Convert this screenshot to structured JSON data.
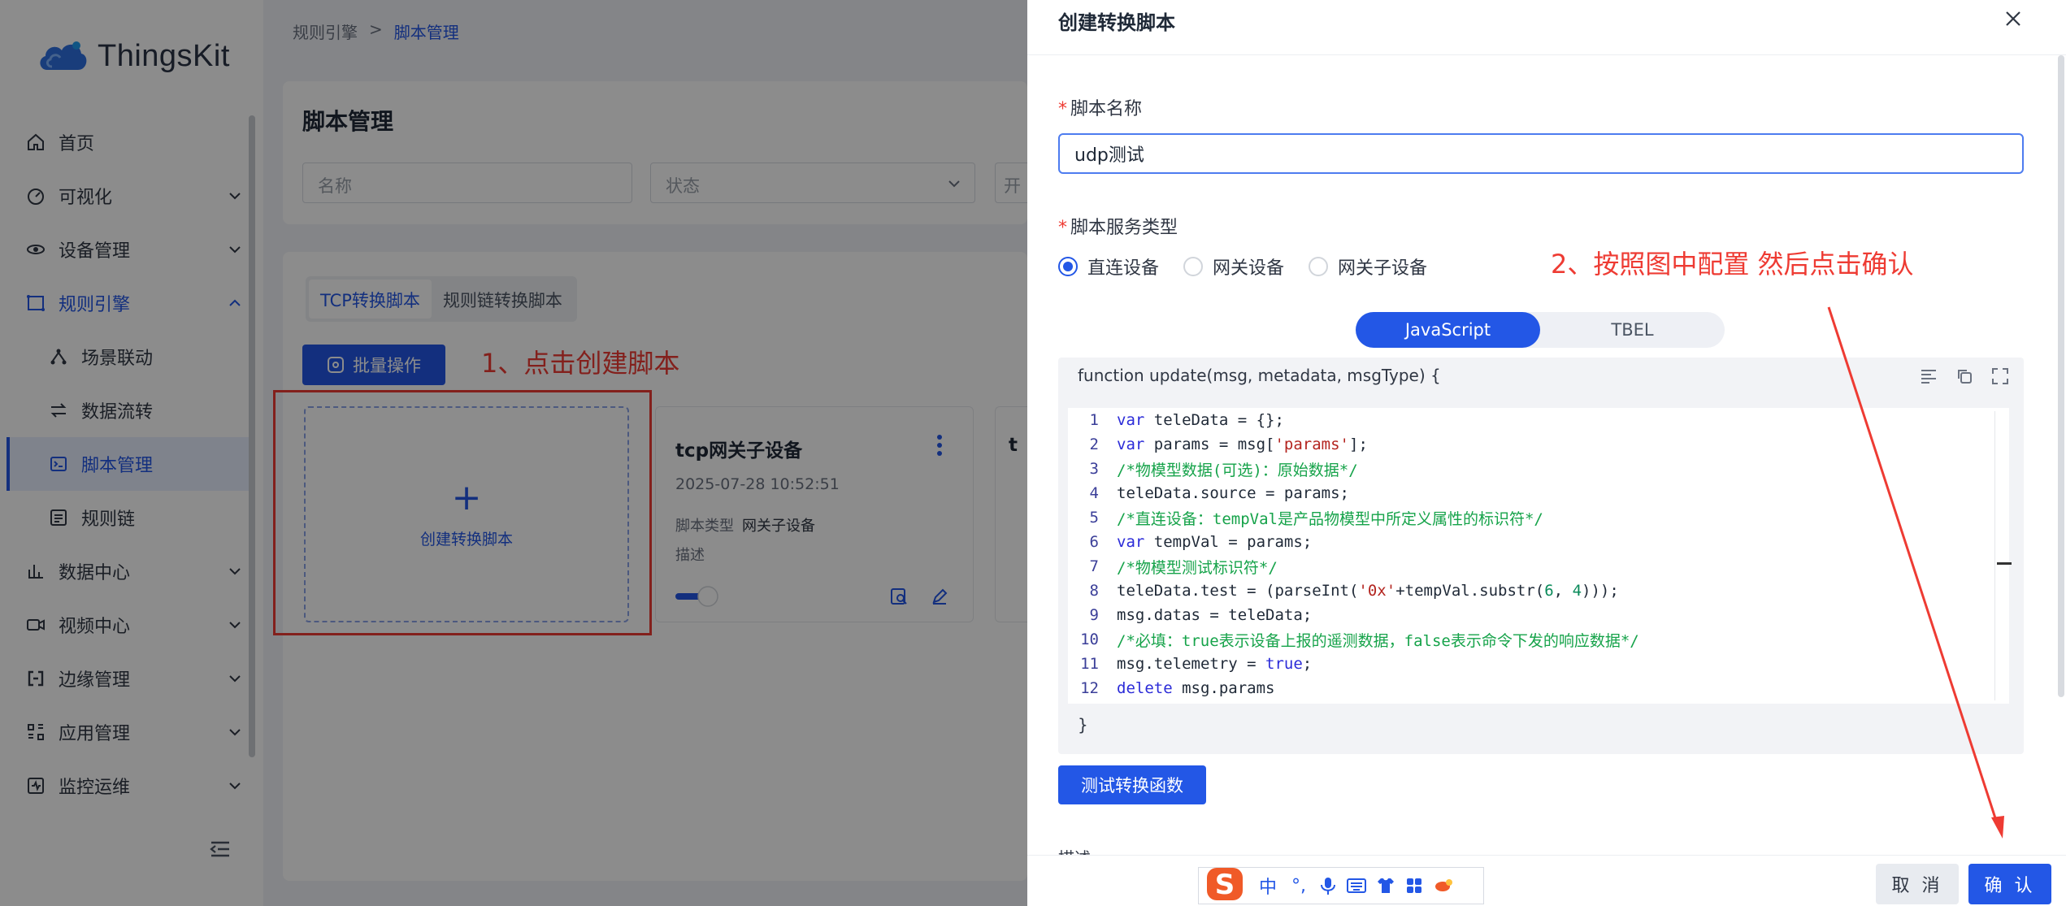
{
  "app": {
    "brand": "ThingsKit",
    "menu": [
      {
        "label": "首页",
        "icon": "home-icon",
        "chevron": false,
        "sub": false,
        "state": ""
      },
      {
        "label": "可视化",
        "icon": "dashboard-icon",
        "chevron": true,
        "sub": false,
        "state": ""
      },
      {
        "label": "设备管理",
        "icon": "device-icon",
        "chevron": true,
        "sub": false,
        "state": ""
      },
      {
        "label": "规则引擎",
        "icon": "rule-engine-icon",
        "chevron": true,
        "sub": false,
        "state": "parent-active"
      },
      {
        "label": "场景联动",
        "icon": "scene-icon",
        "chevron": false,
        "sub": true,
        "state": ""
      },
      {
        "label": "数据流转",
        "icon": "flow-icon",
        "chevron": false,
        "sub": true,
        "state": ""
      },
      {
        "label": "脚本管理",
        "icon": "script-icon",
        "chevron": false,
        "sub": true,
        "state": "active"
      },
      {
        "label": "规则链",
        "icon": "chain-icon",
        "chevron": false,
        "sub": true,
        "state": ""
      },
      {
        "label": "数据中心",
        "icon": "data-icon",
        "chevron": true,
        "sub": false,
        "state": ""
      },
      {
        "label": "视频中心",
        "icon": "video-icon",
        "chevron": true,
        "sub": false,
        "state": ""
      },
      {
        "label": "边缘管理",
        "icon": "edge-icon",
        "chevron": true,
        "sub": false,
        "state": ""
      },
      {
        "label": "应用管理",
        "icon": "app-icon",
        "chevron": true,
        "sub": false,
        "state": ""
      },
      {
        "label": "监控运维",
        "icon": "monitor-icon",
        "chevron": true,
        "sub": false,
        "state": ""
      }
    ],
    "breadcrumb": {
      "parent": "规则引擎",
      "sep": ">",
      "current": "脚本管理"
    },
    "page_title": "脚本管理",
    "filters": {
      "name_placeholder": "名称",
      "status_placeholder": "状态",
      "third_partial": "开"
    },
    "tabs": [
      "TCP转换脚本",
      "规则链转换脚本"
    ],
    "bulk_button": "批量操作",
    "create_card_label": "创建转换脚本",
    "create_plus": "+",
    "card": {
      "title": "tcp网关子设备",
      "date": "2025-07-28 10:52:51",
      "type_label": "脚本类型",
      "type_value": "网关子设备",
      "desc_label": "描述"
    },
    "card_peek_title": "t",
    "annotation1": "1、点击创建脚本"
  },
  "drawer": {
    "title": "创建转换脚本",
    "name_label": "脚本名称",
    "name_value": "udp测试",
    "service_label": "脚本服务类型",
    "radios": [
      {
        "label": "直连设备",
        "checked": true
      },
      {
        "label": "网关设备",
        "checked": false
      },
      {
        "label": "网关子设备",
        "checked": false
      }
    ],
    "annotation2": "2、按照图中配置 然后点击确认",
    "langs": [
      {
        "label": "JavaScript",
        "active": true
      },
      {
        "label": "TBEL",
        "active": false
      }
    ],
    "editor_head": "function update(msg, metadata, msgType) {",
    "editor_foot": "}",
    "code_lines": [
      "var teleData = {};",
      "var params = msg['params'];",
      "/*物模型数据(可选)：原始数据*/",
      "teleData.source = params;",
      "/*直连设备：tempVal是产品物模型中所定义属性的标识符*/",
      "var tempVal = params;",
      "/*物模型测试标识符*/",
      "teleData.test = (parseInt('0x'+tempVal.substr(6, 4)));",
      "msg.datas = teleData;",
      "/*必填：true表示设备上报的遥测数据，false表示命令下发的响应数据*/",
      "msg.telemetry = true;",
      "delete msg.params"
    ],
    "test_button": "测试转换函数",
    "desc_peek": "描述",
    "ime_items": [
      "中",
      "°,",
      "mic",
      "kbd",
      "shirt",
      "grid",
      "tool"
    ],
    "cancel": "取 消",
    "ok": "确 认"
  }
}
